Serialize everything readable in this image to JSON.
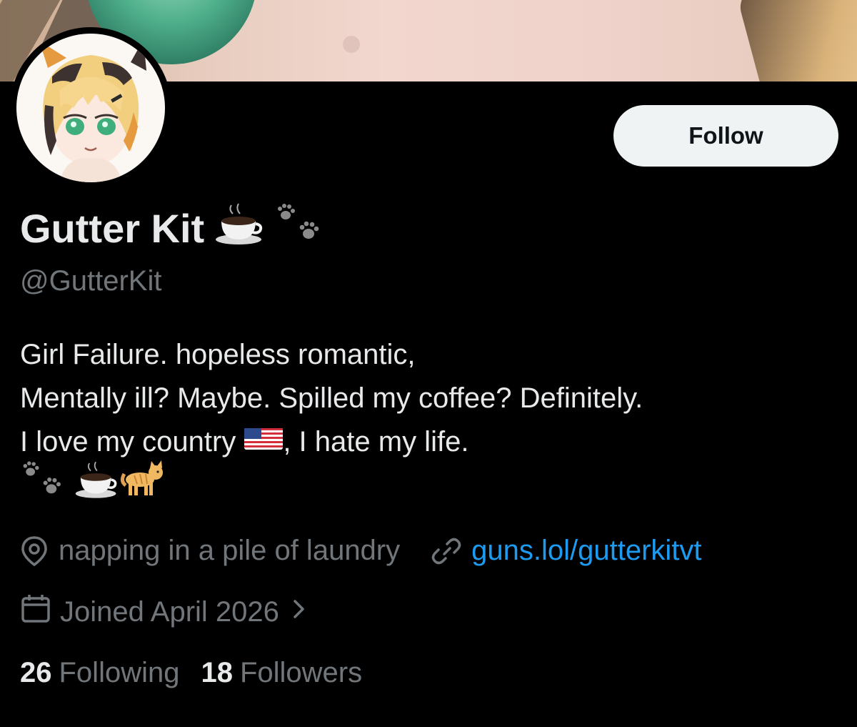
{
  "profile": {
    "display_name": "Gutter Kit",
    "handle": "@GutterKit",
    "follow_label": "Follow",
    "bio": {
      "line1": "Girl Failure. hopeless romantic,",
      "line2": "Mentally ill? Maybe. Spilled my coffee? Definitely.",
      "line3_before": "I love my country",
      "line3_after": ", I hate my life."
    },
    "location": "napping in a pile of laundry",
    "website": "guns.lol/gutterkitvt",
    "joined": "Joined April 2026",
    "stats": {
      "following_count": "26",
      "following_label": "Following",
      "followers_count": "18",
      "followers_label": "Followers"
    }
  },
  "icons": {
    "name_emojis": [
      "coffee-icon",
      "paw-prints-icon"
    ],
    "bio_emojis": [
      "paw-prints-icon",
      "coffee-icon",
      "cat-icon"
    ],
    "flag": "us-flag-icon",
    "location": "location-pin-icon",
    "website": "link-icon",
    "joined": "calendar-icon",
    "joined_chevron": "chevron-right-icon"
  },
  "colors": {
    "background": "#000000",
    "text_primary": "#e7e9ea",
    "text_secondary": "#71767b",
    "link": "#1d9bf0",
    "follow_button_bg": "#eff3f4"
  }
}
